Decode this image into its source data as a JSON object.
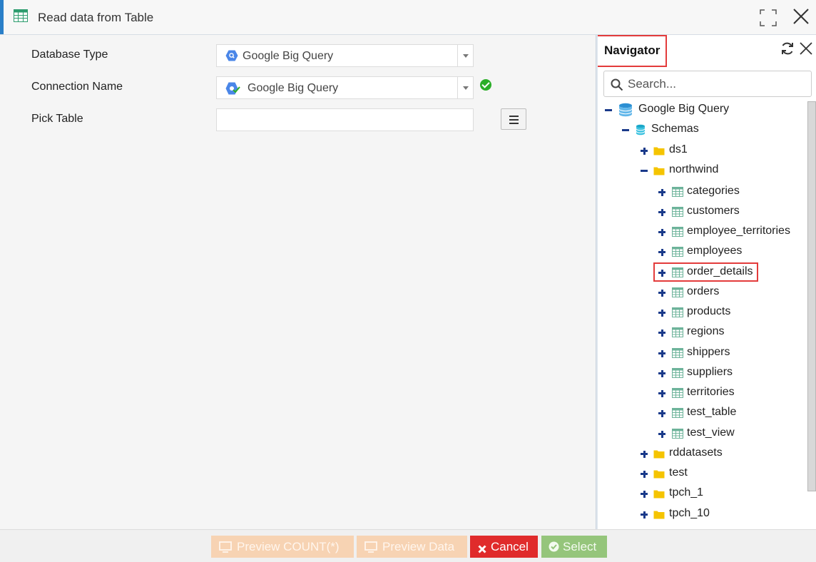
{
  "window": {
    "title": "Read data from Table",
    "icon": "table-icon"
  },
  "form": {
    "database_type": {
      "label": "Database Type",
      "value": "Google Big Query",
      "icon": "bigquery-icon"
    },
    "connection_name": {
      "label": "Connection Name",
      "value": "Google Big Query",
      "icon": "bigquery-connection-icon",
      "status": "connected"
    },
    "pick_table": {
      "label": "Pick Table",
      "value": ""
    }
  },
  "navigator": {
    "title": "Navigator",
    "search_placeholder": "Search...",
    "tree": [
      {
        "label": "Google Big Query",
        "type": "database",
        "expanded": true,
        "level": 0
      },
      {
        "label": "Schemas",
        "type": "schemas",
        "expanded": true,
        "level": 1
      },
      {
        "label": "ds1",
        "type": "folder",
        "expanded": false,
        "level": 2
      },
      {
        "label": "northwind",
        "type": "folder",
        "expanded": true,
        "level": 2
      },
      {
        "label": "categories",
        "type": "table",
        "expanded": false,
        "level": 3
      },
      {
        "label": "customers",
        "type": "table",
        "expanded": false,
        "level": 3
      },
      {
        "label": "employee_territories",
        "type": "table",
        "expanded": false,
        "level": 3
      },
      {
        "label": "employees",
        "type": "table",
        "expanded": false,
        "level": 3
      },
      {
        "label": "order_details",
        "type": "table",
        "expanded": false,
        "level": 3,
        "highlighted": true
      },
      {
        "label": "orders",
        "type": "table",
        "expanded": false,
        "level": 3
      },
      {
        "label": "products",
        "type": "table",
        "expanded": false,
        "level": 3
      },
      {
        "label": "regions",
        "type": "table",
        "expanded": false,
        "level": 3
      },
      {
        "label": "shippers",
        "type": "table",
        "expanded": false,
        "level": 3
      },
      {
        "label": "suppliers",
        "type": "table",
        "expanded": false,
        "level": 3
      },
      {
        "label": "territories",
        "type": "table",
        "expanded": false,
        "level": 3
      },
      {
        "label": "test_table",
        "type": "table",
        "expanded": false,
        "level": 3
      },
      {
        "label": "test_view",
        "type": "table",
        "expanded": false,
        "level": 3
      },
      {
        "label": "rddatasets",
        "type": "folder",
        "expanded": false,
        "level": 2
      },
      {
        "label": "test",
        "type": "folder",
        "expanded": false,
        "level": 2
      },
      {
        "label": "tpch_1",
        "type": "folder",
        "expanded": false,
        "level": 2
      },
      {
        "label": "tpch_10",
        "type": "folder",
        "expanded": false,
        "level": 2
      }
    ]
  },
  "footer": {
    "preview_count": "Preview COUNT(*)",
    "preview_data": "Preview Data",
    "cancel": "Cancel",
    "select": "Select"
  },
  "colors": {
    "accent": "#2a7fc8",
    "highlight_border": "#e33b3b",
    "cancel": "#e02b2b",
    "select": "#95c57b",
    "preview_disabled": "#f7d3b3",
    "tree_toggle": "#1a3a8a",
    "folder": "#f5c400"
  }
}
